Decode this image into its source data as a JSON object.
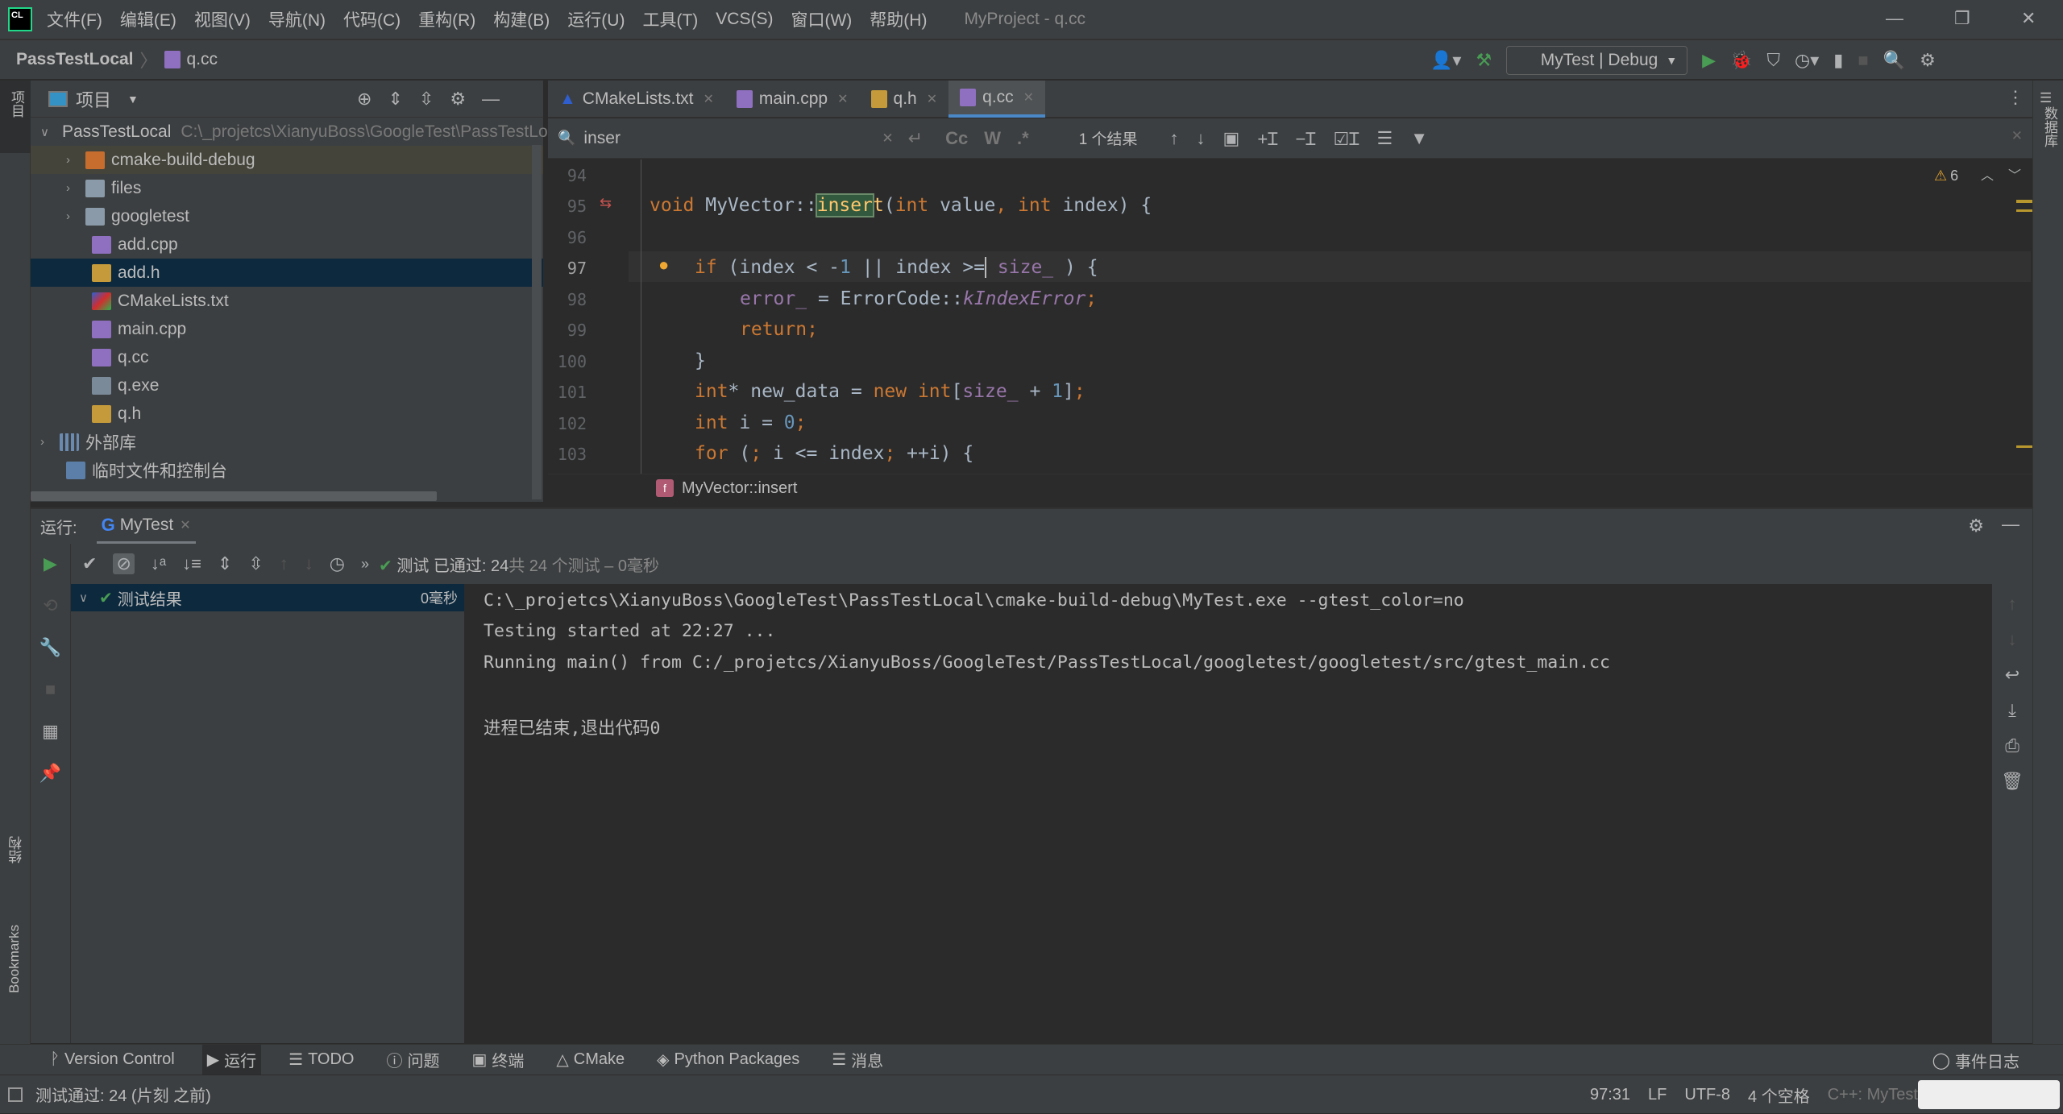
{
  "window": {
    "title": "MyProject - q.cc",
    "menu": [
      "文件(F)",
      "编辑(E)",
      "视图(V)",
      "导航(N)",
      "代码(C)",
      "重构(R)",
      "构建(B)",
      "运行(U)",
      "工具(T)",
      "VCS(S)",
      "窗口(W)",
      "帮助(H)"
    ]
  },
  "navbar": {
    "project": "PassTestLocal",
    "file": "q.cc",
    "run_config": "MyTest | Debug"
  },
  "project_panel": {
    "title": "项目",
    "tree": [
      {
        "label": "PassTestLocal",
        "path": "C:\\_projetcs\\XianyuBoss\\GoogleTest\\PassTestLocal",
        "type": "folder",
        "expanded": true
      },
      {
        "label": "cmake-build-debug",
        "type": "folder-orange"
      },
      {
        "label": "files",
        "type": "folder"
      },
      {
        "label": "googletest",
        "type": "folder"
      },
      {
        "label": "add.cpp",
        "type": "cpp"
      },
      {
        "label": "add.h",
        "type": "h",
        "selected": true
      },
      {
        "label": "CMakeLists.txt",
        "type": "cmake"
      },
      {
        "label": "main.cpp",
        "type": "cpp"
      },
      {
        "label": "q.cc",
        "type": "cpp"
      },
      {
        "label": "q.exe",
        "type": "exe"
      },
      {
        "label": "q.h",
        "type": "h"
      },
      {
        "label": "外部库",
        "type": "lib"
      },
      {
        "label": "临时文件和控制台",
        "type": "scratch"
      }
    ]
  },
  "tabs": [
    {
      "label": "CMakeLists.txt"
    },
    {
      "label": "main.cpp"
    },
    {
      "label": "q.h"
    },
    {
      "label": "q.cc",
      "active": true
    }
  ],
  "search": {
    "query": "inser",
    "result": "1 个结果",
    "opts": [
      "Cc",
      "W",
      ".*"
    ]
  },
  "editor": {
    "warnings": "6",
    "breadcrumb": "MyVector::insert",
    "lines": [
      "94",
      "95",
      "96",
      "97",
      "98",
      "99",
      "100",
      "101",
      "102",
      "103"
    ]
  },
  "run": {
    "label": "运行:",
    "tab": "MyTest",
    "status_pass": "测试 已通过: 24",
    "status_total": "共 24 个测试 – 0毫秒",
    "tree_root": "测试结果",
    "tree_time": "0毫秒",
    "console": [
      "C:\\_projetcs\\XianyuBoss\\GoogleTest\\PassTestLocal\\cmake-build-debug\\MyTest.exe --gtest_color=no",
      "Testing started at 22:27 ...",
      "Running main() from C:/_projetcs/XianyuBoss/GoogleTest/PassTestLocal/googletest/googletest/src/gtest_main.cc",
      "",
      "进程已结束,退出代码0"
    ]
  },
  "bottom_tools": [
    "Version Control",
    "运行",
    "TODO",
    "问题",
    "终端",
    "CMake",
    "Python Packages",
    "消息"
  ],
  "event_log": "事件日志",
  "status": {
    "message": "测试通过: 24 (片刻 之前)",
    "position": "97:31",
    "line_sep": "LF",
    "encoding": "UTF-8",
    "indent": "4 个空格",
    "context": "C++: MyTest"
  },
  "stripes": {
    "left_top": "项目",
    "left_mid": "结构",
    "left_bottom": "Bookmarks",
    "right": "数据库"
  }
}
